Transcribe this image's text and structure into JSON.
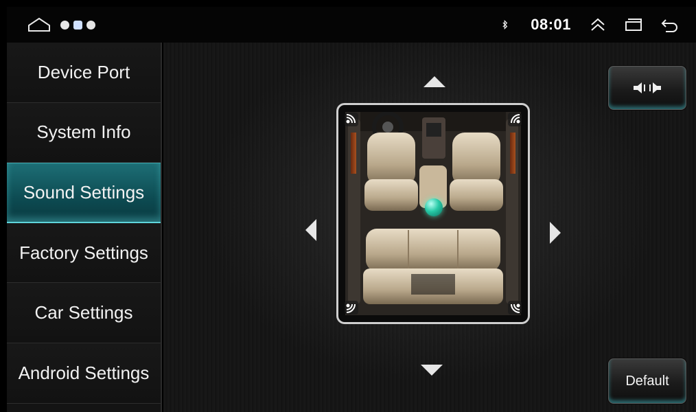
{
  "status_bar": {
    "time": "08:01",
    "icons": [
      "home-icon",
      "shield-notification-icon",
      "app-notification-icon",
      "mic-notification-icon",
      "bluetooth-icon",
      "expand-icon",
      "recent-apps-icon",
      "back-icon"
    ]
  },
  "sidebar": {
    "items": [
      {
        "label": "Device Port"
      },
      {
        "label": "System Info"
      },
      {
        "label": "Sound Settings"
      },
      {
        "label": "Factory Settings"
      },
      {
        "label": "Car Settings"
      },
      {
        "label": "Android Settings"
      }
    ],
    "active_index": 2
  },
  "sound_panel": {
    "default_label": "Default",
    "balance_button_icon": "speaker-balance-icon",
    "colors": {
      "accent": "#5fd6dc",
      "active_tab": "#0d4b52",
      "balance_dot": "#27c9a6"
    }
  }
}
